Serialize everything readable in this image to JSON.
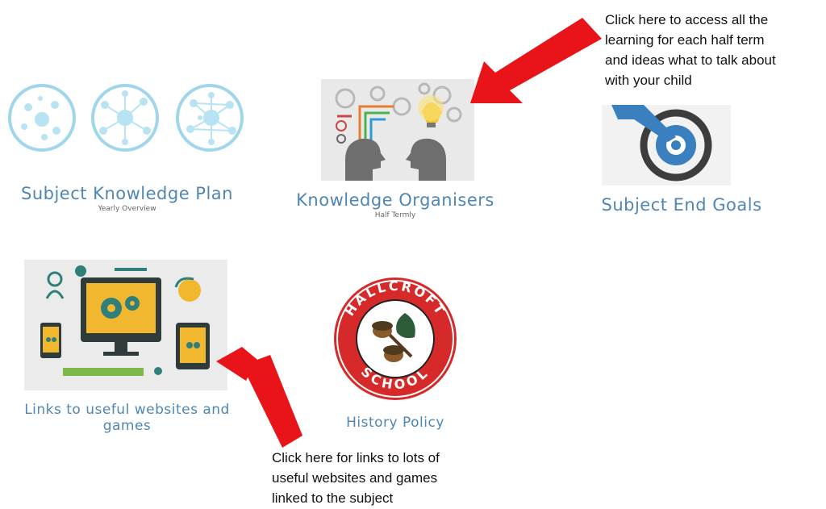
{
  "tiles": {
    "skp": {
      "title": "Subject Knowledge Plan",
      "subtitle": "Yearly Overview"
    },
    "ko": {
      "title": "Knowledge Organisers",
      "subtitle": "Half Termly"
    },
    "seg": {
      "title": "Subject End Goals"
    },
    "links": {
      "title_line1": "Links to useful websites and",
      "title_line2": "games"
    },
    "policy": {
      "title": "History Policy"
    }
  },
  "logo": {
    "top_text": "HALLCROFT",
    "bottom_text": "SCHOOL"
  },
  "notes": {
    "top": [
      "Click here to access all the",
      "learning for each half term",
      "and ideas what to talk about",
      "with your child"
    ],
    "bottom": [
      "Click here for links to lots of",
      "useful websites and games",
      "linked to the subject"
    ]
  },
  "colors": {
    "accent": "#4f86b3",
    "arrow": "#e8141a",
    "logo_red": "#d62a2a"
  }
}
